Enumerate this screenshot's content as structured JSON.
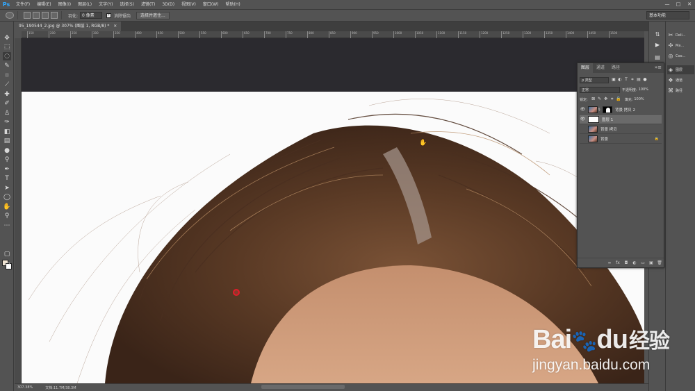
{
  "app": {
    "logo": "Ps"
  },
  "menu": [
    "文件(F)",
    "编辑(E)",
    "图像(I)",
    "图层(L)",
    "文字(Y)",
    "选择(S)",
    "滤镜(T)",
    "3D(D)",
    "视图(V)",
    "窗口(W)",
    "帮助(H)"
  ],
  "window_controls": {
    "minimize": "—",
    "maximize": "□",
    "close": "✕"
  },
  "options": {
    "feather_label": "羽化:",
    "feather_value": "0 像素",
    "antialias_label": "消除锯齿",
    "antialias_checked": true,
    "select_mask_button": "选择并遮住...",
    "workspace": "基本功能"
  },
  "document": {
    "tab_title": "95_190544_2.jpg @ 307% (图层 1, RGB/8) *",
    "close": "×"
  },
  "ruler": [
    "150",
    "200",
    "250",
    "300",
    "350",
    "400",
    "450",
    "500",
    "550",
    "600",
    "650",
    "700",
    "750",
    "800",
    "850",
    "900",
    "950",
    "1000",
    "1050",
    "1100",
    "1150",
    "1200",
    "1250",
    "1300",
    "1350",
    "1400",
    "1450",
    "1500"
  ],
  "status": {
    "zoom": "307.38%",
    "doc_info": "文档:11.7M/38.3M"
  },
  "side_panels": [
    {
      "icon": "history-icon",
      "label": "Deli..."
    },
    {
      "icon": "actions-icon",
      "label": "Ma..."
    },
    {
      "icon": "color-icon",
      "label": "Coo..."
    }
  ],
  "panel_group": [
    {
      "label": "图层",
      "active": true
    },
    {
      "label": "通道",
      "active": false
    },
    {
      "label": "路径",
      "active": false
    }
  ],
  "layers_panel": {
    "tabs": [
      {
        "label": "图层",
        "active": true
      },
      {
        "label": "通道",
        "active": false
      },
      {
        "label": "路径",
        "active": false
      }
    ],
    "menu_glyph": "»≡",
    "filter_kind": "ρ 类型",
    "blend_mode": "正常",
    "opacity_label": "不透明度:",
    "opacity_value": "100%",
    "lock_label": "锁定:",
    "fill_label": "填充:",
    "fill_value": "100%",
    "layers": [
      {
        "name": "背景 拷贝 2",
        "visible": true,
        "selected": false,
        "thumb": "photo",
        "has_mask": true,
        "locked": false
      },
      {
        "name": "图层 1",
        "visible": true,
        "selected": true,
        "thumb": "white",
        "has_mask": false,
        "locked": false
      },
      {
        "name": "背景 拷贝",
        "visible": false,
        "selected": false,
        "thumb": "photo",
        "has_mask": false,
        "locked": false
      },
      {
        "name": "背景",
        "visible": false,
        "selected": false,
        "thumb": "photo",
        "has_mask": false,
        "locked": true
      }
    ],
    "bottom_icons": [
      "∞",
      "fx",
      "◘",
      "◐",
      "▭",
      "▣",
      "🗑"
    ]
  },
  "colors": {
    "foreground": "#f1e4d2",
    "background": "#ffffff",
    "cursor": "#e21c2a"
  },
  "watermark": {
    "brand": "Bai",
    "brand_paw": "du",
    "brand_cn": "经验",
    "url": "jingyan.baidu.com"
  }
}
